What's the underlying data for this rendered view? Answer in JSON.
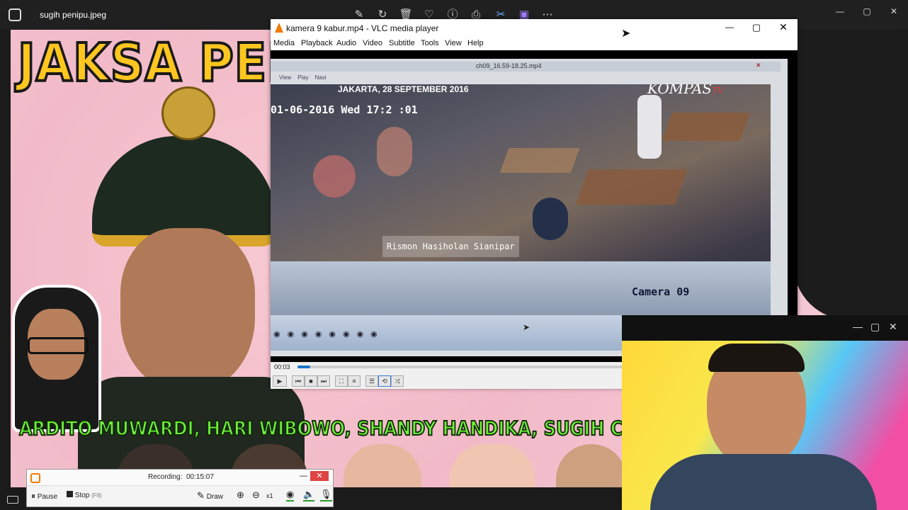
{
  "viewer": {
    "title": "sugih penipu.jpeg",
    "toolbar_icons": [
      "edit-icon",
      "rotate-icon",
      "delete-icon",
      "heart-icon",
      "info-icon",
      "print-icon",
      "shortcut-icon",
      "app-icon",
      "more-icon"
    ]
  },
  "photo": {
    "headline": "JAKSA PENG",
    "names_banner": "ARDITO MUWARDI, HARI WIBOWO, SHANDY HANDIKA, SUGIH CARVALLO, MAYLAN"
  },
  "vlc": {
    "title": "kamera 9 kabur.mp4 - VLC media player",
    "menu": [
      "Media",
      "Playback",
      "Audio",
      "Video",
      "Subtitle",
      "Tools",
      "View",
      "Help"
    ],
    "video": {
      "inner_window_title": "ch09_16.59-18.25.mp4",
      "inner_menu": [
        "View",
        "Play",
        "Navi"
      ],
      "location_date": "JAKARTA, 28 SEPTEMBER 2016",
      "channel": "KOMPAS",
      "channel_suffix": "TV",
      "timestamp": "01-06-2016 Wed 17:2 :01",
      "watermark": "Rismon Hasiholan Sianipar",
      "camera_label": "Camera 09"
    },
    "elapsed": "00:03",
    "progress": 0.04
  },
  "recorder": {
    "label": "Recording:",
    "time": "00:15:07",
    "pause": "Pause",
    "stop": "Stop",
    "stop_shortcut": "(F8)",
    "draw": "Draw",
    "zoom": "x1"
  },
  "colors": {
    "headline": "#ffc61f",
    "banner": "#6ef03a",
    "vlc_progress": "#1e73c8"
  }
}
